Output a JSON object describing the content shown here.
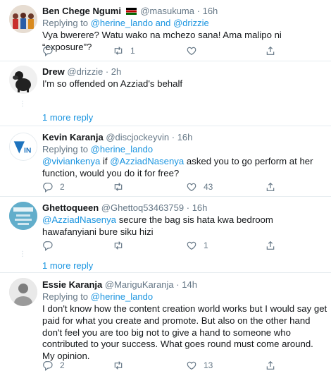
{
  "tweets": [
    {
      "name": "Ben Chege Ngumi",
      "handle": "@masukuma",
      "time": "16h",
      "replying_label": "Replying to",
      "replying_to": "@herine_lando and @drizzie",
      "body": "Vya bwerere? Watu wako na mchezo sana! Ama malipo ni “exposure”?",
      "reply_count": "",
      "retweet_count": "1",
      "like_count": ""
    },
    {
      "name": "Drew",
      "handle": "@drizzie",
      "time": "2h",
      "body": "I'm so offended on Azziad's behalf",
      "more_replies": "1 more reply"
    },
    {
      "name": "Kevin Karanja",
      "handle": "@discjockeyvin",
      "time": "16h",
      "replying_label": "Replying to",
      "replying_to": "@herine_lando",
      "mention_1": "@viviankenya",
      "body_mid": " if ",
      "mention_2": "@AzziadNasenya",
      "body_rest": " asked you to go perform at her function, would you do it for free?",
      "reply_count": "2",
      "retweet_count": "",
      "like_count": "43"
    },
    {
      "name": "Ghettoqueen",
      "handle": "@Ghettoq53463759",
      "time": "16h",
      "mention": "@AzziadNasenya",
      "body_rest": " secure the bag sis hata kwa bedroom hawafanyiani bure siku hizi",
      "reply_count": "",
      "retweet_count": "",
      "like_count": "1",
      "more_replies": "1 more reply"
    },
    {
      "name": "Essie Karanja",
      "handle": "@MariguKaranja",
      "time": "14h",
      "replying_label": "Replying to",
      "replying_to": "@herine_lando",
      "body": "I don't know how the content creation world works but I would say get paid for what you create and promote. But also on the other hand don't feel you are too big not to give a hand to someone who contributed to your success. What goes round must come around.\nMy opinion.",
      "reply_count": "2",
      "retweet_count": "",
      "like_count": "13"
    }
  ],
  "separator": "·",
  "colors": {
    "link": "#1b95e0",
    "muted": "#657786",
    "divider": "#e6ecf0"
  }
}
